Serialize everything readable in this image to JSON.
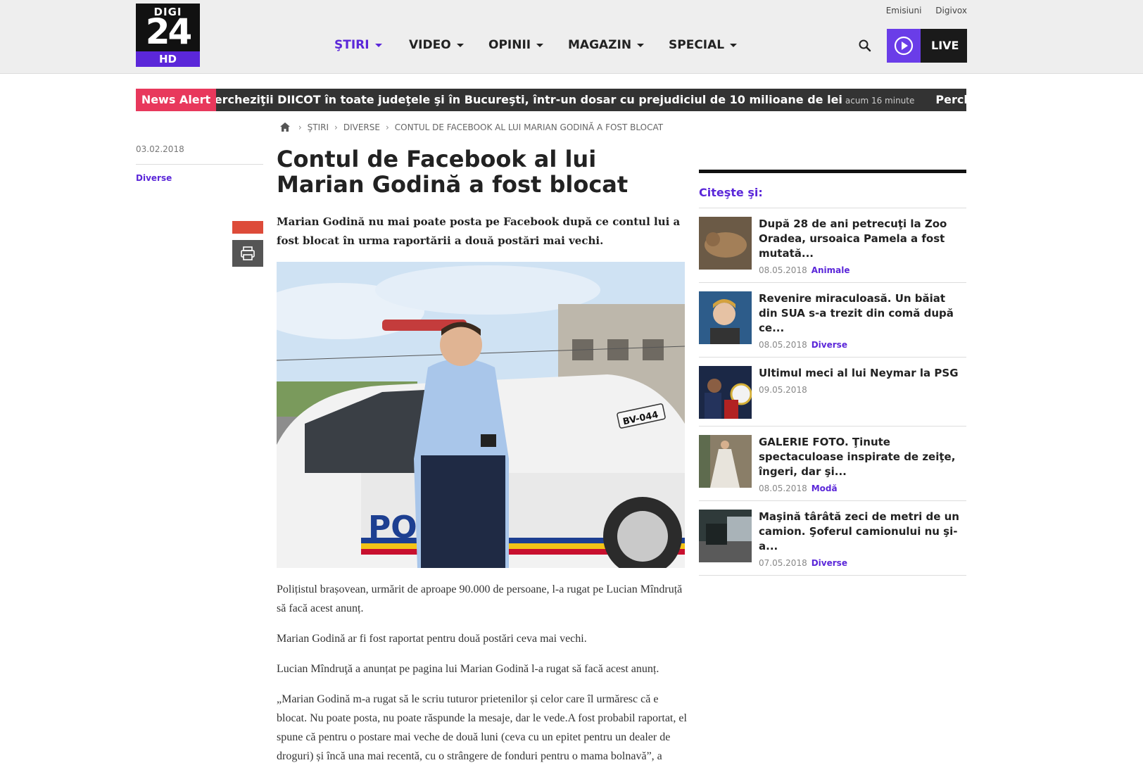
{
  "logo": {
    "top": "DIGI",
    "number": "24",
    "hd": "HD"
  },
  "top_links": [
    "Emisiuni",
    "Digivox"
  ],
  "nav": [
    {
      "label": "ŞTIRI",
      "active": true
    },
    {
      "label": "VIDEO",
      "active": false
    },
    {
      "label": "OPINII",
      "active": false
    },
    {
      "label": "MAGAZIN",
      "active": false
    },
    {
      "label": "SPECIAL",
      "active": false
    }
  ],
  "live": {
    "label": "LIVE"
  },
  "news_alert": {
    "tag": "News Alert",
    "headline": "Percheziţii DIICOT în toate judeţele şi în Bucureşti, într-un dosar cu prejudiciul de 10 milioane de lei",
    "time": "acum 16 minute",
    "headline_repeat": "Percheziţii DIICOT în"
  },
  "breadcrumb": [
    "ŞTIRI",
    "DIVERSE",
    "CONTUL DE FACEBOOK AL LUI MARIAN GODINĂ A FOST BLOCAT"
  ],
  "article": {
    "date": "03.02.2018",
    "category": "Diverse",
    "title": "Contul de Facebook al lui Marian Godină a fost blocat",
    "lead": "Marian Godină nu mai poate posta pe Facebook după ce contul lui a fost blocat în urma raportării a două postări mai vechi.",
    "paragraphs": [
      "Polițistul brașovean, urmărit de aproape 90.000 de persoane, l-a rugat pe Lucian Mîndruță să facă acest anunț.",
      "Marian Godină ar fi fost raportat pentru două postări ceva mai vechi.",
      "Lucian Mîndruţă a anunțat pe pagina lui Marian Godină l-a rugat să facă acest anunț.",
      "„Marian Godină m-a rugat să le scriu tuturor prietenilor și celor care îl urmăresc că e blocat. Nu poate posta, nu poate răspunde la mesaje, dar le vede.A fost probabil raportat, el spune că pentru o postare mai veche de două luni (ceva cu un epitet pentru un dealer de droguri) și încă una mai recentă, cu o strângere de fonduri pentru o mama bolnavă”, a"
    ]
  },
  "sidebar": {
    "heading": "Citeşte şi:",
    "items": [
      {
        "title": "După 28 de ani petrecuţi la Zoo Oradea, ursoaica Pamela a fost mutată...",
        "date": "08.05.2018",
        "category": "Animale"
      },
      {
        "title": "Revenire miraculoasă. Un băiat din SUA s-a trezit din comă după ce...",
        "date": "08.05.2018",
        "category": "Diverse"
      },
      {
        "title": "Ultimul meci al lui Neymar la PSG",
        "date": "09.05.2018",
        "category": ""
      },
      {
        "title": "GALERIE FOTO. Ţinute spectaculoase inspirate de zeiţe, îngeri, dar şi...",
        "date": "08.05.2018",
        "category": "Modă"
      },
      {
        "title": "Maşină târâtă zeci de metri de un camion. Şoferul camionului nu şi-a...",
        "date": "07.05.2018",
        "category": "Diverse"
      }
    ]
  },
  "photo": {
    "plate": "BV-044",
    "door_text": "POLIŢIA"
  },
  "colors": {
    "accent": "#5b27d9",
    "alert": "#e8385c",
    "live_play": "#6a3de8"
  }
}
